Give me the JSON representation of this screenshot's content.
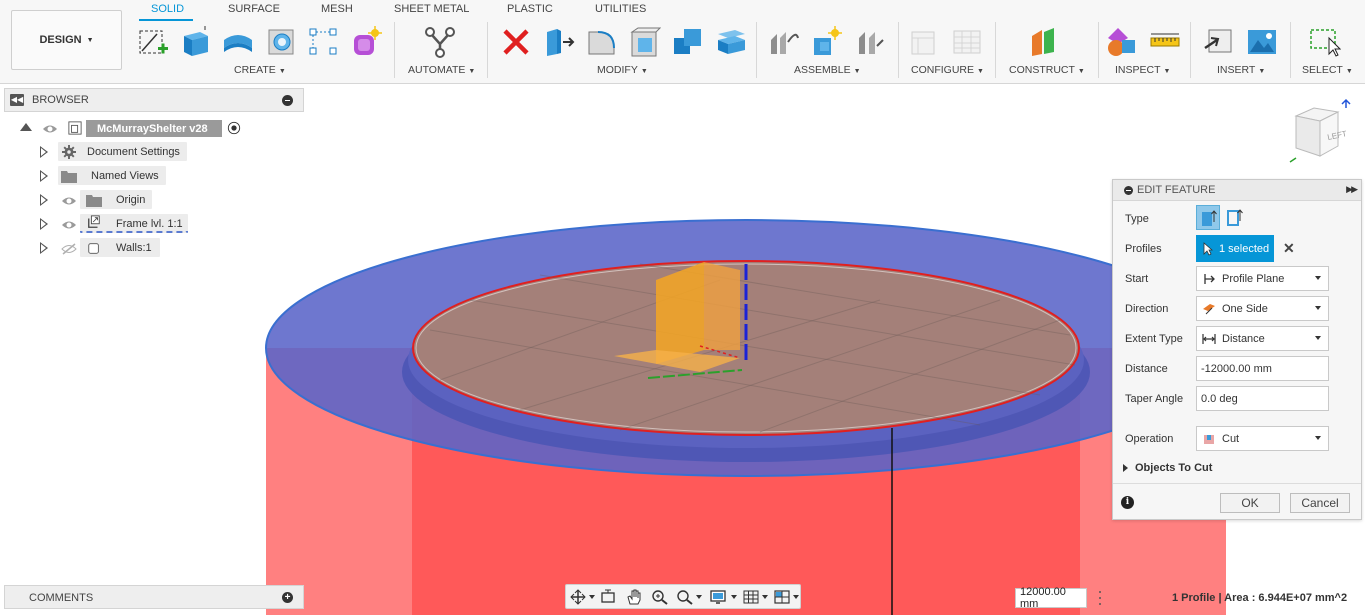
{
  "toolbar": {
    "workspace_button": "DESIGN",
    "tabs": [
      "SOLID",
      "SURFACE",
      "MESH",
      "SHEET METAL",
      "PLASTIC",
      "UTILITIES"
    ],
    "active_tab": "SOLID",
    "groups": {
      "create": "CREATE",
      "automate": "AUTOMATE",
      "modify": "MODIFY",
      "assemble": "ASSEMBLE",
      "configure": "CONFIGURE",
      "construct": "CONSTRUCT",
      "inspect": "INSPECT",
      "insert": "INSERT",
      "select": "SELECT"
    }
  },
  "browser": {
    "title": "BROWSER",
    "root": "McMurrayShelter v28",
    "items": [
      {
        "label": "Document Settings",
        "icon": "gear-icon"
      },
      {
        "label": "Named Views",
        "icon": "folder-icon"
      },
      {
        "label": "Origin",
        "icon": "folder-icon"
      },
      {
        "label": "Frame lvl. 1:1",
        "icon": "component-link-icon"
      },
      {
        "label": "Walls:1",
        "icon": "body-icon"
      }
    ]
  },
  "viewcube": {
    "face": "LEFT"
  },
  "edit_feature": {
    "title": "EDIT FEATURE",
    "labels": {
      "type": "Type",
      "profiles": "Profiles",
      "start": "Start",
      "direction": "Direction",
      "extent_type": "Extent Type",
      "distance": "Distance",
      "taper_angle": "Taper Angle",
      "operation": "Operation"
    },
    "profiles_value": "1 selected",
    "start_value": "Profile Plane",
    "direction_value": "One Side",
    "extent_value": "Distance",
    "distance_value": "-12000.00 mm",
    "taper_value": "0.0 deg",
    "operation_value": "Cut",
    "objects_to_cut": "Objects To Cut",
    "ok": "OK",
    "cancel": "Cancel"
  },
  "comments": {
    "title": "COMMENTS"
  },
  "measure_value": "12000.00 mm",
  "status_text": "1 Profile | Area : 6.944E+07 mm^2",
  "colors": {
    "accent": "#0696d7",
    "solid_red": "#ff5c5c",
    "blue_ring": "#5e6cc9",
    "profile_fill": "#a07f78",
    "frame_orange": "#f5a623"
  }
}
